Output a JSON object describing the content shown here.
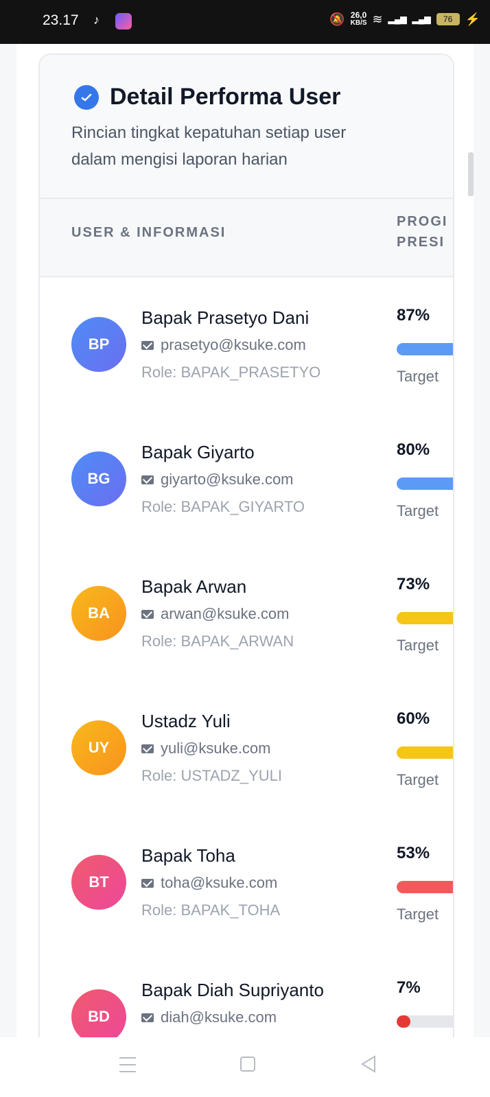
{
  "status_bar": {
    "time": "23.17",
    "network_speed_value": "26,0",
    "network_speed_unit": "KB/S",
    "battery": "76"
  },
  "card": {
    "title": "Detail Performa User",
    "subtitle": "Rincian tingkat kepatuhan setiap user dalam mengisi laporan harian",
    "icon": "check-circle-icon"
  },
  "table": {
    "headers": {
      "user": "USER & INFORMASI",
      "progress_line1": "PROGI",
      "progress_line2": "PRESI"
    },
    "rows": [
      {
        "initials": "BP",
        "name": "Bapak Prasetyo Dani",
        "email": "prasetyo@ksuke.com",
        "role": "Role: BAPAK_PRASETYO",
        "percent": "87%",
        "progress": 0.87,
        "target": "Target",
        "avatar_color_from": "#4f8cf6",
        "avatar_color_to": "#6b6ef0",
        "bar_color": "#5b9af5"
      },
      {
        "initials": "BG",
        "name": "Bapak Giyarto",
        "email": "giyarto@ksuke.com",
        "role": "Role: BAPAK_GIYARTO",
        "percent": "80%",
        "progress": 0.8,
        "target": "Target",
        "avatar_color_from": "#4f8cf6",
        "avatar_color_to": "#6b6ef0",
        "bar_color": "#5b9af5"
      },
      {
        "initials": "BA",
        "name": "Bapak Arwan",
        "email": "arwan@ksuke.com",
        "role": "Role: BAPAK_ARWAN",
        "percent": "73%",
        "progress": 0.73,
        "target": "Target",
        "avatar_color_from": "#f9b81b",
        "avatar_color_to": "#f7931e",
        "bar_color": "#f5c518"
      },
      {
        "initials": "UY",
        "name": "Ustadz Yuli",
        "email": "yuli@ksuke.com",
        "role": "Role: USTADZ_YULI",
        "percent": "60%",
        "progress": 0.6,
        "target": "Target",
        "avatar_color_from": "#f9b81b",
        "avatar_color_to": "#f7931e",
        "bar_color": "#f5c518"
      },
      {
        "initials": "BT",
        "name": "Bapak Toha",
        "email": "toha@ksuke.com",
        "role": "Role: BAPAK_TOHA",
        "percent": "53%",
        "progress": 0.53,
        "target": "Target",
        "avatar_color_from": "#f05a6e",
        "avatar_color_to": "#ec4899",
        "bar_color": "#ef5b5b"
      },
      {
        "initials": "BD",
        "name": "Bapak Diah Supriyanto",
        "email": "diah@ksuke.com",
        "role": "",
        "percent": "7%",
        "progress": 0.07,
        "target": "",
        "avatar_color_from": "#f05a6e",
        "avatar_color_to": "#ec4899",
        "bar_color": "#e53935"
      }
    ]
  }
}
